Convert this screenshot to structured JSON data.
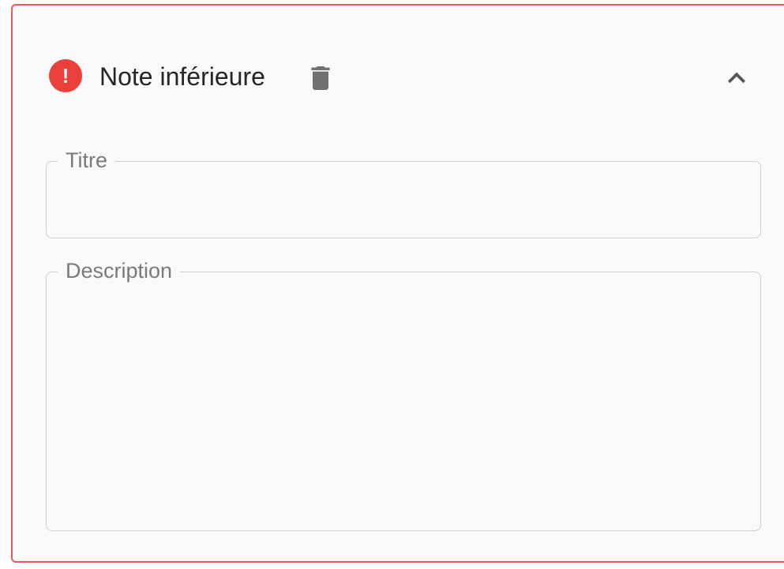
{
  "panel": {
    "title": "Note inférieure",
    "status_icon": "error-icon",
    "status_glyph": "!",
    "delete_icon": "trash-icon",
    "collapse_icon": "chevron-up-icon",
    "accent_color": "#ea3f3a"
  },
  "fields": {
    "title": {
      "label": "Titre",
      "value": "",
      "placeholder": ""
    },
    "description": {
      "label": "Description",
      "value": "",
      "placeholder": ""
    }
  }
}
